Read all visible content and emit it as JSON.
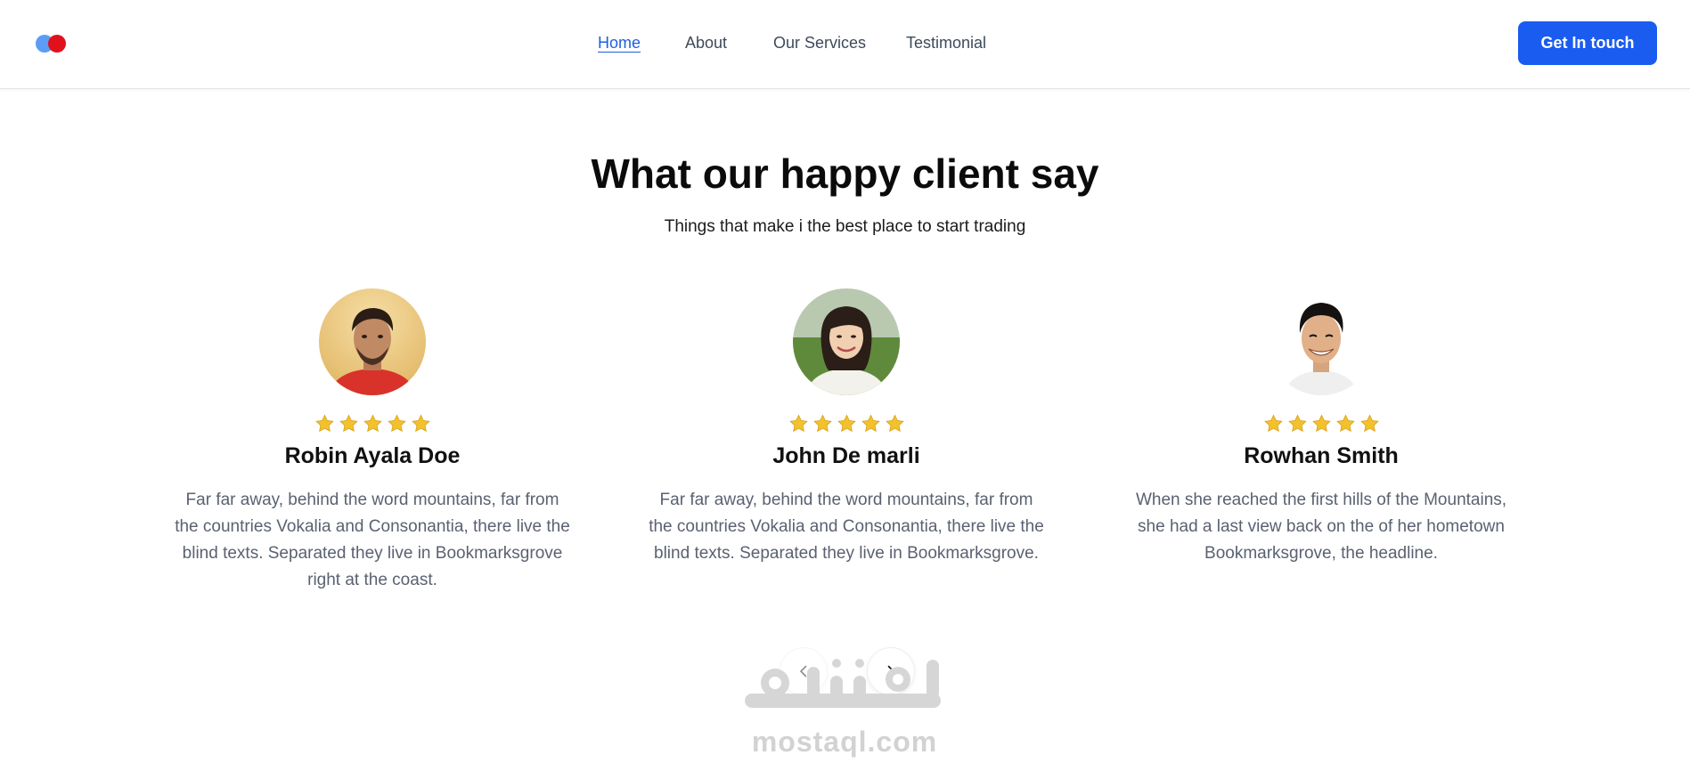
{
  "nav": {
    "links": [
      "Home",
      "About",
      "Our Services",
      "Testimonial"
    ],
    "active": "Home",
    "cta_label": "Get In touch"
  },
  "brand": {
    "logo_colors": [
      "#5b9df5",
      "#e0111b"
    ],
    "accent": "#1a5cf0"
  },
  "section": {
    "title": "What our happy client say",
    "subtitle": "Things that make i the best place to start trading"
  },
  "testimonials": [
    {
      "name": "Robin Ayala Doe",
      "rating": 5,
      "quote": "Far far away, behind the word mountains, far from the countries Vokalia and Consonantia, there live the blind texts. Separated they live in Bookmarksgrove right at the coast."
    },
    {
      "name": "John De marli",
      "rating": 5,
      "quote": "Far far away, behind the word mountains, far from the countries Vokalia and Consonantia, there live the blind texts. Separated they live in Bookmarksgrove."
    },
    {
      "name": "Rowhan Smith",
      "rating": 5,
      "quote": "When she reached the first hills of the Mountains, she had a last view back on the of her hometown Bookmarksgrove, the headline."
    }
  ],
  "carousel": {
    "prev_icon": "chevron-left-icon",
    "next_icon": "chevron-right-icon"
  },
  "watermark": {
    "text": "mostaql.com",
    "arabic": "مستقل"
  }
}
